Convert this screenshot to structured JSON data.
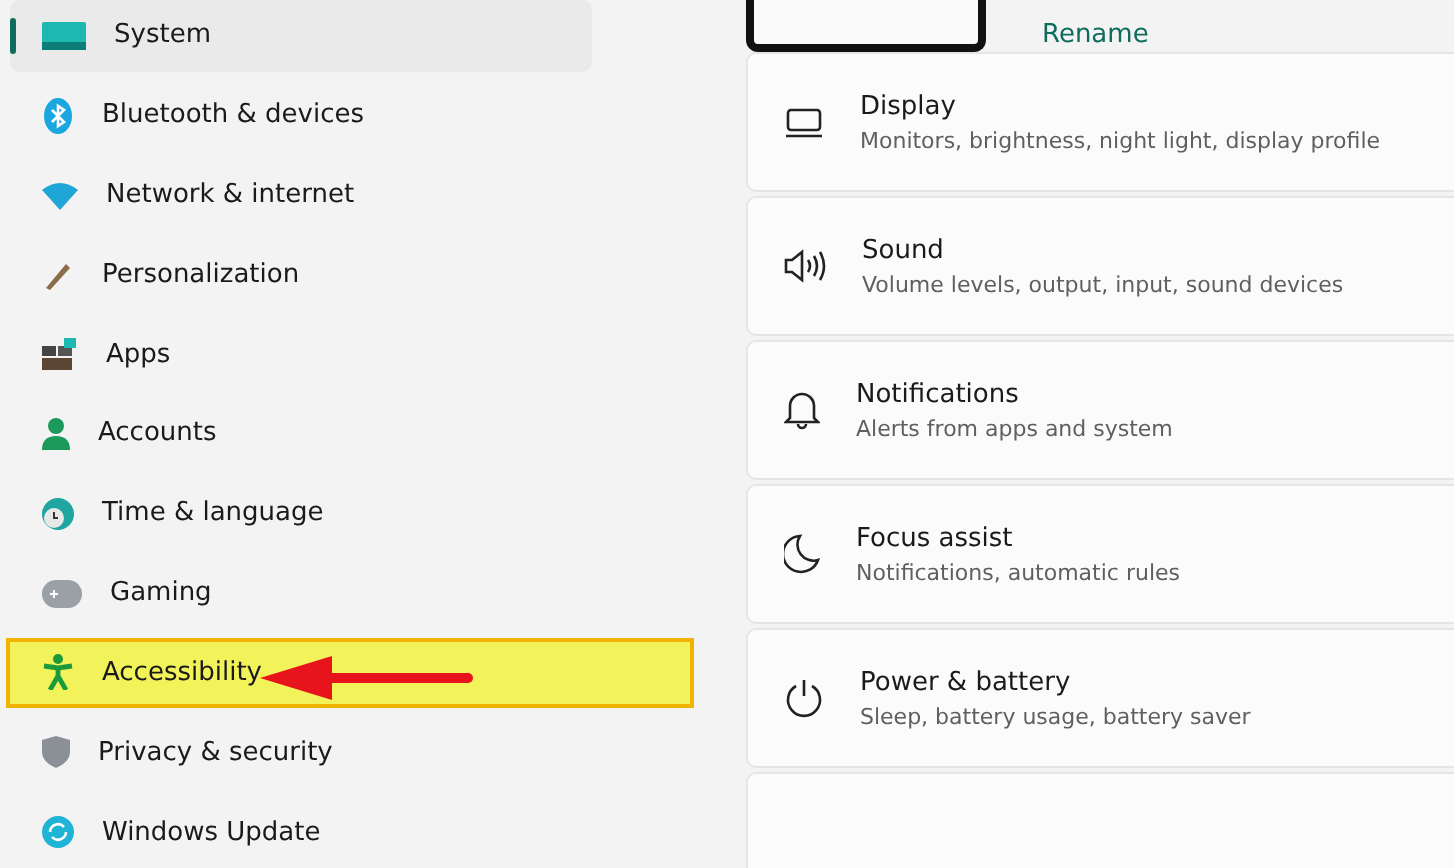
{
  "sidebar": {
    "items": [
      {
        "label": "System",
        "selected": true,
        "highlighted": false
      },
      {
        "label": "Bluetooth & devices",
        "selected": false,
        "highlighted": false
      },
      {
        "label": "Network & internet",
        "selected": false,
        "highlighted": false
      },
      {
        "label": "Personalization",
        "selected": false,
        "highlighted": false
      },
      {
        "label": "Apps",
        "selected": false,
        "highlighted": false
      },
      {
        "label": "Accounts",
        "selected": false,
        "highlighted": false
      },
      {
        "label": "Time & language",
        "selected": false,
        "highlighted": false
      },
      {
        "label": "Gaming",
        "selected": false,
        "highlighted": false
      },
      {
        "label": "Accessibility",
        "selected": false,
        "highlighted": true
      },
      {
        "label": "Privacy & security",
        "selected": false,
        "highlighted": false
      },
      {
        "label": "Windows Update",
        "selected": false,
        "highlighted": false
      }
    ]
  },
  "device": {
    "rename_link": "Rename"
  },
  "settings": [
    {
      "title": "Display",
      "subtitle": "Monitors, brightness, night light, display profile"
    },
    {
      "title": "Sound",
      "subtitle": "Volume levels, output, input, sound devices"
    },
    {
      "title": "Notifications",
      "subtitle": "Alerts from apps and system"
    },
    {
      "title": "Focus assist",
      "subtitle": "Notifications, automatic rules"
    },
    {
      "title": "Power & battery",
      "subtitle": "Sleep, battery usage, battery saver"
    }
  ]
}
